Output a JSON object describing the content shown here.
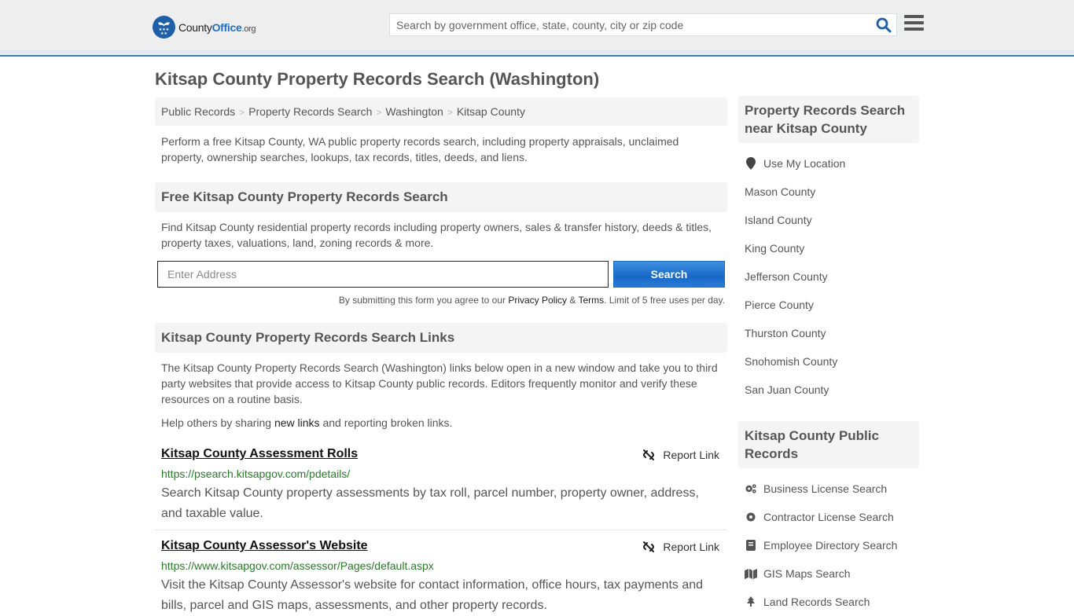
{
  "header": {
    "logo": {
      "prefix": "County",
      "brand": "Office",
      "suffix": ".org"
    },
    "search_placeholder": "Search by government office, state, county, city or zip code",
    "search_icon": "search-icon",
    "menu_icon": "hamburger-menu-icon"
  },
  "page": {
    "title": "Kitsap County Property Records Search (Washington)"
  },
  "breadcrumb": [
    {
      "label": "Public Records"
    },
    {
      "label": "Property Records Search"
    },
    {
      "label": "Washington"
    },
    {
      "label": "Kitsap County"
    }
  ],
  "intro": "Perform a free Kitsap County, WA public property records search, including property appraisals, unclaimed property, ownership searches, lookups, tax records, titles, deeds, and liens.",
  "free_search": {
    "heading": "Free Kitsap County Property Records Search",
    "description": "Find Kitsap County residential property records including property owners, sales & transfer history, deeds & titles, property taxes, valuations, land, zoning records & more.",
    "address_placeholder": "Enter Address",
    "button_label": "Search",
    "terms_prefix": "By submitting this form you agree to our ",
    "privacy_label": "Privacy Policy",
    "amp": " & ",
    "terms_label": "Terms",
    "terms_suffix": ". Limit of 5 free uses per day."
  },
  "links_section": {
    "heading": "Kitsap County Property Records Search Links",
    "description": "The Kitsap County Property Records Search (Washington) links below open in a new window and take you to third party websites that provide access to Kitsap County public records. Editors frequently monitor and verify these resources on a routine basis.",
    "help_prefix": "Help others by sharing ",
    "help_link": "new links",
    "help_suffix": " and reporting broken links.",
    "report_label": "Report Link",
    "items": [
      {
        "title": "Kitsap County Assessment Rolls",
        "url": "https://psearch.kitsapgov.com/pdetails/",
        "description": "Search Kitsap County property assessments by tax roll, parcel number, property owner, address, and taxable value."
      },
      {
        "title": "Kitsap County Assessor's Website",
        "url": "https://www.kitsapgov.com/assessor/Pages/default.aspx",
        "description": "Visit the Kitsap County Assessor's website for contact information, office hours, tax payments and bills, parcel and GIS maps, assessments, and other property records."
      }
    ]
  },
  "sidebar": {
    "nearby": {
      "heading": "Property Records Search near Kitsap County",
      "use_location": "Use My Location",
      "counties": [
        "Mason County",
        "Island County",
        "King County",
        "Jefferson County",
        "Pierce County",
        "Thurston County",
        "Snohomish County",
        "San Juan County"
      ]
    },
    "public_records": {
      "heading": "Kitsap County Public Records",
      "items": [
        {
          "label": "Business License Search",
          "icon": "gears-icon"
        },
        {
          "label": "Contractor License Search",
          "icon": "gear-icon"
        },
        {
          "label": "Employee Directory Search",
          "icon": "book-icon"
        },
        {
          "label": "GIS Maps Search",
          "icon": "map-icon"
        },
        {
          "label": "Land Records Search",
          "icon": "tree-icon"
        }
      ]
    }
  },
  "colors": {
    "brand_blue": "#1e6fc0",
    "header_border": "#3a7fb4",
    "button_blue": "#1867c7",
    "url_green": "#2a7a2a"
  }
}
